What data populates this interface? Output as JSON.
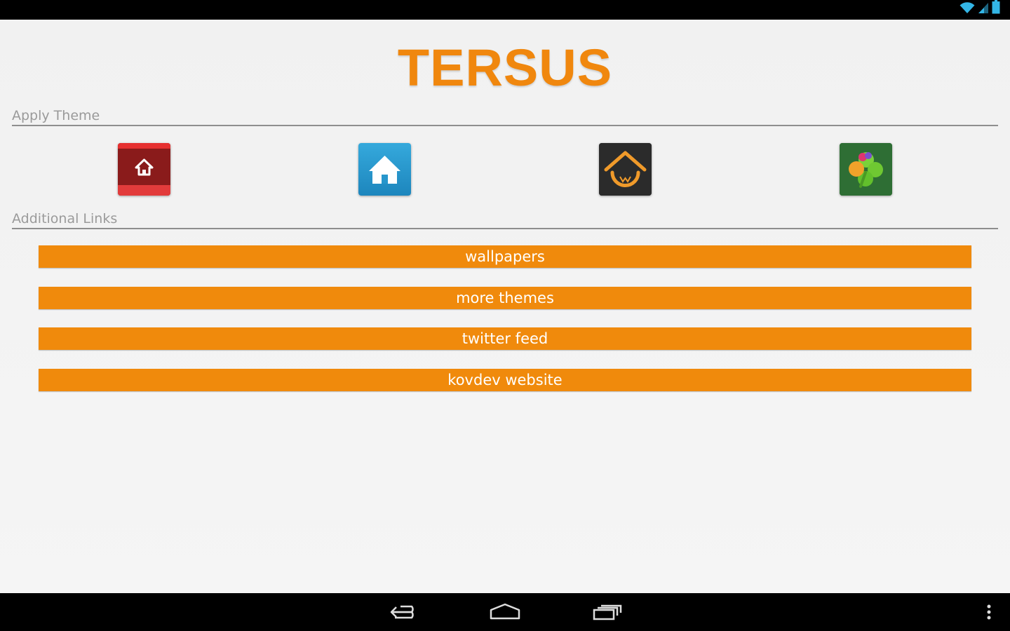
{
  "app": {
    "title": "TERSUS",
    "accent_color": "#f08a0c"
  },
  "sections": {
    "apply_theme": "Apply Theme",
    "additional_links": "Additional Links"
  },
  "launchers": [
    {
      "icon": "red-house-icon"
    },
    {
      "icon": "blue-house-icon"
    },
    {
      "icon": "dark-house-icon"
    },
    {
      "icon": "clover-icon"
    }
  ],
  "links": [
    {
      "label": "wallpapers"
    },
    {
      "label": "more themes"
    },
    {
      "label": "twitter feed"
    },
    {
      "label": "kovdev website"
    }
  ],
  "status_bar": {
    "icons": [
      "wifi-icon",
      "cell-signal-icon",
      "battery-icon"
    ]
  },
  "nav_bar": {
    "icons": [
      "back-icon",
      "home-icon",
      "recent-apps-icon",
      "menu-icon"
    ]
  }
}
